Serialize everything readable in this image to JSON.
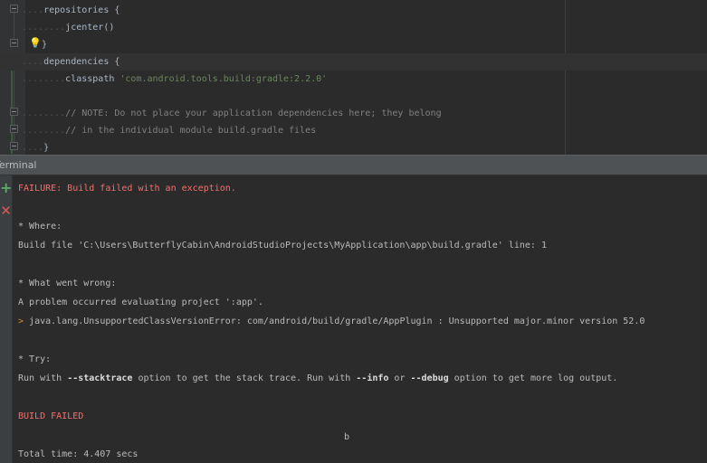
{
  "editor": {
    "lines": {
      "repositories": {
        "dots": "....",
        "text": "repositories {"
      },
      "jcenter": {
        "dots": "........",
        "text": "jcenter()"
      },
      "close1": {
        "text": "}"
      },
      "dependencies": {
        "dots": "....",
        "text": "dependencies {"
      },
      "classpath": {
        "dots": "........",
        "kw": "classpath ",
        "str": "'com.android.tools.build:gradle:2.2.0'"
      },
      "note1": {
        "dots": "........",
        "text": "// NOTE: Do not place your application dependencies here; they belong"
      },
      "note2": {
        "dots": "........",
        "text": "// in the individual module build.gradle files"
      },
      "close2": {
        "dots": "....",
        "text": "}"
      }
    }
  },
  "terminal": {
    "title": "Terminal",
    "failure": "FAILURE: Build failed with an exception.",
    "where_heading": "* Where:",
    "build_file": "Build file 'C:\\Users\\ButterflyCabin\\AndroidStudioProjects\\MyApplication\\app\\build.gradle' line: 1",
    "wrong_heading": "* What went wrong:",
    "problem": "A problem occurred evaluating project ':app'.",
    "error_arrow": ">",
    "error_text": " java.lang.UnsupportedClassVersionError: com/android/build/gradle/AppPlugin : Unsupported major.minor version 52.0",
    "try_heading": "* Try:",
    "run_with_1": "Run with ",
    "stacktrace": "--stacktrace",
    "mid_1": " option to get the stack trace. Run with ",
    "info": "--info",
    "or": " or ",
    "debug": "--debug",
    "tail": " option to get more log output.",
    "build_failed": "BUILD FAILED",
    "stray": "b",
    "total_time": "Total time: 4.407 secs"
  },
  "icons": {
    "add": "+",
    "close": "✕",
    "bulb": "💡"
  },
  "colors": {
    "error_red": "#ff6b68",
    "add_green": "#59a869",
    "close_red": "#e05555"
  }
}
